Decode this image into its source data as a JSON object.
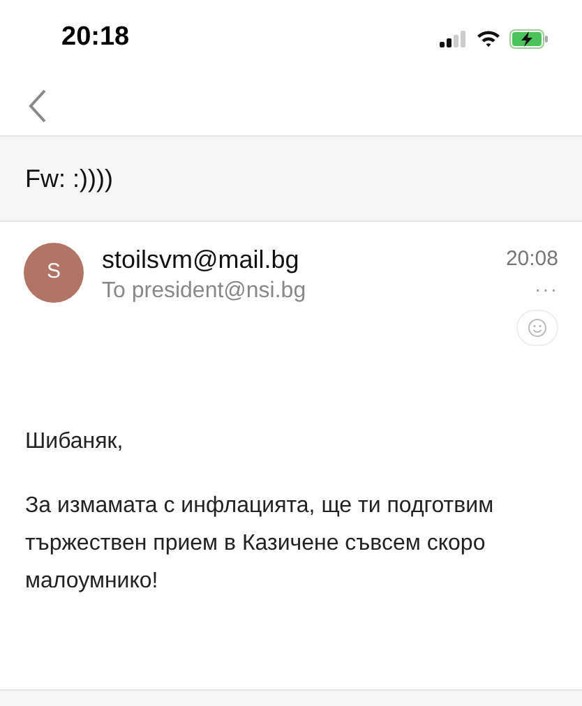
{
  "status_bar": {
    "time": "20:18"
  },
  "subject": "Fw: :))))",
  "message": {
    "avatar_letter": "S",
    "sender": "stoilsvm@mail.bg",
    "recipient": "To president@nsi.bg",
    "time": "20:08",
    "more": "···"
  },
  "body": [
    "Шибаняк,",
    "За измамата с инфлацията, ще ти подготвим тържествен прием в Казичене съвсем скоро малоумнико!"
  ]
}
